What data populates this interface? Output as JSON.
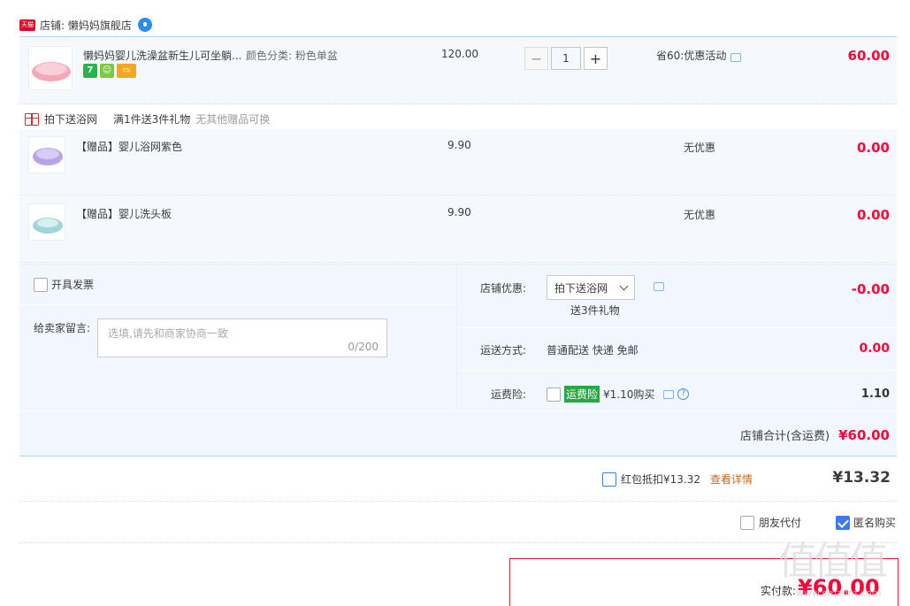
{
  "shop": {
    "badge": "天猫",
    "name": "店铺: 懒妈妈旗舰店"
  },
  "main_item": {
    "title": "懒妈妈婴儿洗澡盆新生儿可坐躺...",
    "sku": "颜色分类: 粉色单盆",
    "price": "120.00",
    "qty": "1",
    "minus": "−",
    "plus": "+",
    "promo": "省60:优惠活动",
    "total": "60.00",
    "service_icons": [
      {
        "name": "seven-day-return-icon",
        "text": "7",
        "color": "#2bb24c"
      },
      {
        "name": "authentic-icon",
        "text": "☺",
        "color": "#7ac943"
      },
      {
        "name": "credit-card-icon",
        "text": "▭",
        "color": "#f5a623"
      }
    ]
  },
  "gift_section": {
    "label": "拍下送浴网",
    "rule": "满1件送3件礼物",
    "note": "无其他赠品可换"
  },
  "gifts": [
    {
      "title": "【赠品】婴儿浴网紫色",
      "price": "9.90",
      "promo": "无优惠",
      "total": "0.00"
    },
    {
      "title": "【赠品】婴儿洗头板",
      "price": "9.90",
      "promo": "无优惠",
      "total": "0.00"
    }
  ],
  "invoice": {
    "label": "开具发票"
  },
  "message": {
    "label": "给卖家留言:",
    "placeholder": "选填,请先和商家协商一致",
    "counter": "0/200"
  },
  "shop_discount": {
    "label": "店铺优惠:",
    "selected": "拍下送浴网",
    "sub": "送3件礼物",
    "amount": "-0.00"
  },
  "shipping": {
    "label": "运送方式:",
    "value": "普通配送 快递 免邮",
    "amount": "0.00"
  },
  "freight_insurance": {
    "label": "运费险:",
    "badge": "运费险",
    "price": "¥1.10购买",
    "help": "?",
    "amount": "1.10"
  },
  "shop_total": {
    "label": "店铺合计(含运费)",
    "value": "¥60.00"
  },
  "red_packet": {
    "label": "红包抵扣¥13.32",
    "link": "查看详情",
    "amount": "¥13.32"
  },
  "options": {
    "friend_pay": "朋友代付",
    "anonymous": "匿名购买"
  },
  "payment": {
    "label": "实付款:",
    "value": "¥60.00"
  },
  "watermark": {
    "main": "值值值",
    "sub": "www.smzdm.com"
  }
}
